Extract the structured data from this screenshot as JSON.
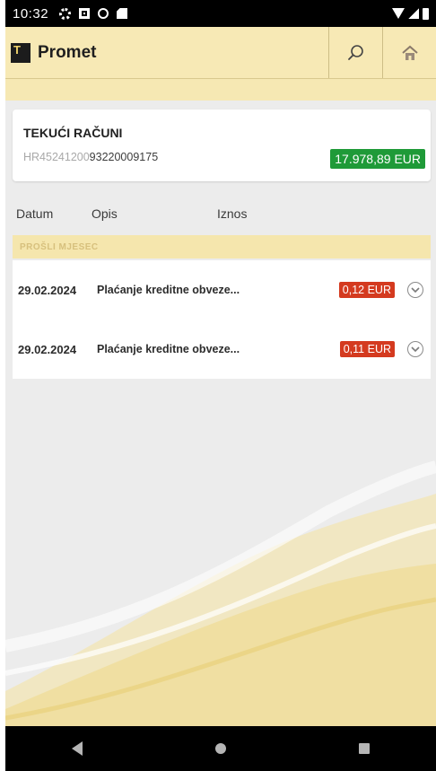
{
  "status_bar": {
    "time": "10:32",
    "icons": [
      "settings-icon",
      "notification-box-icon",
      "circle-sync-icon",
      "sd-card-icon"
    ],
    "right_icons": [
      "wifi-icon",
      "cellular-icon",
      "battery-icon"
    ]
  },
  "app_bar": {
    "logo_letter": "T",
    "title": "Promet",
    "actions": [
      "search-icon",
      "home-icon"
    ]
  },
  "account": {
    "title": "TEKUĆI RAČUNI",
    "iban_prefix": "HR45241200",
    "iban_suffix": "93220009175",
    "balance": "17.978,89 EUR",
    "balance_color": "#1f9a38"
  },
  "columns": {
    "date": "Datum",
    "description": "Opis",
    "amount": "Iznos"
  },
  "section": {
    "label": "PROŠLI MJESEC"
  },
  "transactions": [
    {
      "date": "29.02.2024",
      "description": "Plaćanje kreditne obveze...",
      "amount": "0,12 EUR"
    },
    {
      "date": "29.02.2024",
      "description": "Plaćanje kreditne obveze...",
      "amount": "0,11 EUR"
    }
  ],
  "colors": {
    "accent": "#f7e9b5",
    "debit": "#d43a1f",
    "credit": "#1f9a38"
  }
}
